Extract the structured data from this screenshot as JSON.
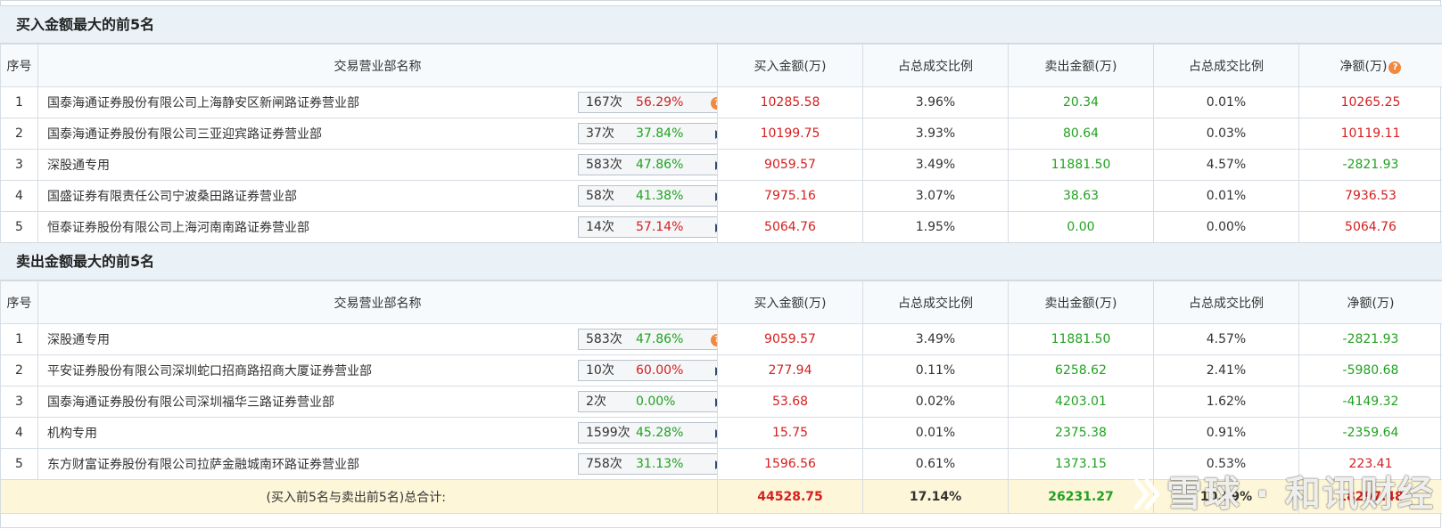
{
  "buy_section": {
    "title": "买入金额最大的前5名",
    "headers": {
      "idx": "序号",
      "name": "交易营业部名称",
      "buy": "买入金额(万)",
      "buy_ratio": "占总成交比例",
      "sell": "卖出金额(万)",
      "sell_ratio": "占总成交比例",
      "net": "净额(万)"
    },
    "rows": [
      {
        "idx": "1",
        "name": "国泰海通证券股份有限公司上海静安区新闸路证券营业部",
        "times": "167次",
        "pct": "56.29%",
        "buy": "10285.58",
        "buy_ratio": "3.96%",
        "sell": "20.34",
        "sell_ratio": "0.01%",
        "net": "10265.25"
      },
      {
        "idx": "2",
        "name": "国泰海通证券股份有限公司三亚迎宾路证券营业部",
        "times": "37次",
        "pct": "37.84%",
        "buy": "10199.75",
        "buy_ratio": "3.93%",
        "sell": "80.64",
        "sell_ratio": "0.03%",
        "net": "10119.11"
      },
      {
        "idx": "3",
        "name": "深股通专用",
        "times": "583次",
        "pct": "47.86%",
        "buy": "9059.57",
        "buy_ratio": "3.49%",
        "sell": "11881.50",
        "sell_ratio": "4.57%",
        "net": "-2821.93"
      },
      {
        "idx": "4",
        "name": "国盛证券有限责任公司宁波桑田路证券营业部",
        "times": "58次",
        "pct": "41.38%",
        "buy": "7975.16",
        "buy_ratio": "3.07%",
        "sell": "38.63",
        "sell_ratio": "0.01%",
        "net": "7936.53"
      },
      {
        "idx": "5",
        "name": "恒泰证券股份有限公司上海河南南路证券营业部",
        "times": "14次",
        "pct": "57.14%",
        "buy": "5064.76",
        "buy_ratio": "1.95%",
        "sell": "0.00",
        "sell_ratio": "0.00%",
        "net": "5064.76"
      }
    ]
  },
  "sell_section": {
    "title": "卖出金额最大的前5名",
    "headers": {
      "idx": "序号",
      "name": "交易营业部名称",
      "buy": "买入金额(万)",
      "buy_ratio": "占总成交比例",
      "sell": "卖出金额(万)",
      "sell_ratio": "占总成交比例",
      "net": "净额(万)"
    },
    "rows": [
      {
        "idx": "1",
        "name": "深股通专用",
        "times": "583次",
        "pct": "47.86%",
        "buy": "9059.57",
        "buy_ratio": "3.49%",
        "sell": "11881.50",
        "sell_ratio": "4.57%",
        "net": "-2821.93"
      },
      {
        "idx": "2",
        "name": "平安证券股份有限公司深圳蛇口招商路招商大厦证券营业部",
        "times": "10次",
        "pct": "60.00%",
        "buy": "277.94",
        "buy_ratio": "0.11%",
        "sell": "6258.62",
        "sell_ratio": "2.41%",
        "net": "-5980.68"
      },
      {
        "idx": "3",
        "name": "国泰海通证券股份有限公司深圳福华三路证券营业部",
        "times": "2次",
        "pct": "0.00%",
        "buy": "53.68",
        "buy_ratio": "0.02%",
        "sell": "4203.01",
        "sell_ratio": "1.62%",
        "net": "-4149.32"
      },
      {
        "idx": "4",
        "name": "机构专用",
        "times": "1599次",
        "pct": "45.28%",
        "buy": "15.75",
        "buy_ratio": "0.01%",
        "sell": "2375.38",
        "sell_ratio": "0.91%",
        "net": "-2359.64"
      },
      {
        "idx": "5",
        "name": "东方财富证券股份有限公司拉萨金融城南环路证券营业部",
        "times": "758次",
        "pct": "31.13%",
        "buy": "1596.56",
        "buy_ratio": "0.61%",
        "sell": "1373.15",
        "sell_ratio": "0.53%",
        "net": "223.41"
      }
    ]
  },
  "total": {
    "label": "(买入前5名与卖出前5名)总合计:",
    "buy": "44528.75",
    "buy_ratio": "17.14%",
    "sell": "26231.27",
    "sell_ratio": "10.09%",
    "net": "18297.48"
  },
  "watermark": {
    "text": "雪球 · 和讯财经"
  },
  "colors": {
    "positive": "#d42020",
    "negative": "#21a121",
    "header_bg": "#eaf2f8",
    "total_bg": "#fdf6d8",
    "help_icon": "#f0883e"
  },
  "icons": {
    "help": "question-mark-icon",
    "expand": "triangle-right-icon"
  }
}
